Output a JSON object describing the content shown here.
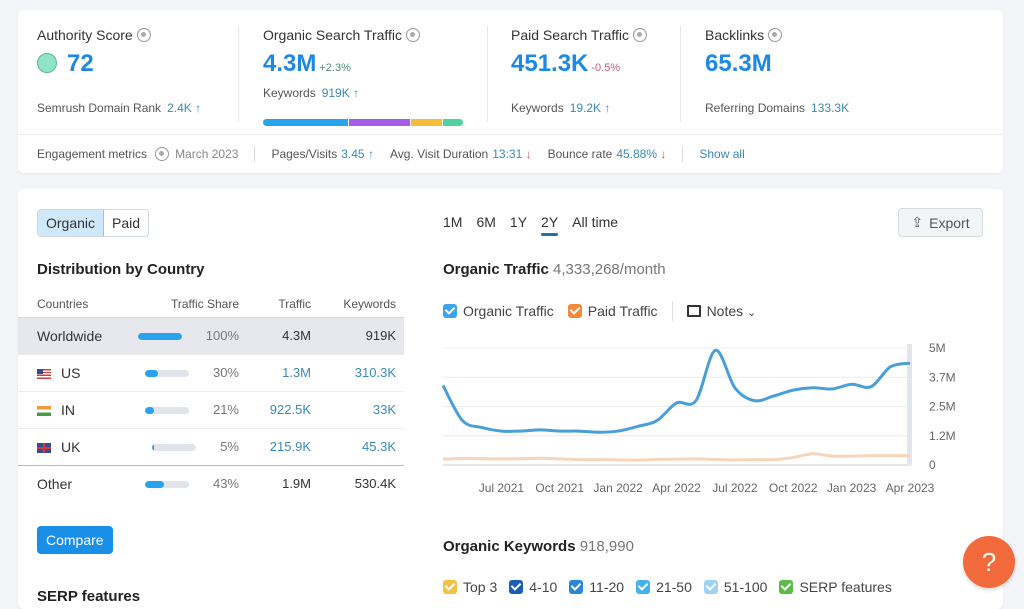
{
  "summary": {
    "authority_score": {
      "title": "Authority Score",
      "value": "72",
      "sub_label": "Semrush Domain Rank",
      "sub_value": "2.4K",
      "sub_trend": "up"
    },
    "organic_search": {
      "title": "Organic Search Traffic",
      "value": "4.3M",
      "delta": "+2.3%",
      "sub_label": "Keywords",
      "sub_value": "919K",
      "sub_trend": "up",
      "keyword_distribution": [
        {
          "color": "#2aa3ef",
          "share": 0.43
        },
        {
          "color": "#a35de8",
          "share": 0.31
        },
        {
          "color": "#f5bd3a",
          "share": 0.16
        },
        {
          "color": "#4fd2a0",
          "share": 0.1
        }
      ]
    },
    "paid_search": {
      "title": "Paid Search Traffic",
      "value": "451.3K",
      "delta": "-0.5%",
      "sub_label": "Keywords",
      "sub_value": "19.2K",
      "sub_trend": "up"
    },
    "backlinks": {
      "title": "Backlinks",
      "value": "65.3M",
      "sub_label": "Referring Domains",
      "sub_value": "133.3K"
    }
  },
  "engagement": {
    "label": "Engagement metrics",
    "date": "March 2023",
    "pages_visits_label": "Pages/Visits",
    "pages_visits": "3.45",
    "pages_visits_trend": "up",
    "avg_duration_label": "Avg. Visit Duration",
    "avg_duration": "13:31",
    "avg_duration_trend": "down",
    "bounce_label": "Bounce rate",
    "bounce": "45.88%",
    "bounce_trend": "down",
    "show_all": "Show all"
  },
  "toggle": {
    "organic": "Organic",
    "paid": "Paid",
    "selected": "Organic"
  },
  "distribution": {
    "title": "Distribution by Country",
    "columns": [
      "Countries",
      "Traffic Share",
      "Traffic",
      "Keywords"
    ],
    "rows": [
      {
        "country": "Worldwide",
        "flag": "",
        "share": 100,
        "share_label": "100%",
        "traffic": "4.3M",
        "keywords": "919K"
      },
      {
        "country": "US",
        "flag": "us",
        "share": 30,
        "share_label": "30%",
        "traffic": "1.3M",
        "keywords": "310.3K"
      },
      {
        "country": "IN",
        "flag": "in",
        "share": 21,
        "share_label": "21%",
        "traffic": "922.5K",
        "keywords": "33K"
      },
      {
        "country": "UK",
        "flag": "uk",
        "share": 5,
        "share_label": "5%",
        "traffic": "215.9K",
        "keywords": "45.3K"
      },
      {
        "country": "Other",
        "flag": "",
        "share": 43,
        "share_label": "43%",
        "traffic": "1.9M",
        "keywords": "530.4K"
      }
    ],
    "compare_label": "Compare",
    "serp_label": "SERP features"
  },
  "range_tabs": [
    "1M",
    "6M",
    "1Y",
    "2Y",
    "All time"
  ],
  "range_selected": "2Y",
  "export_label": "Export",
  "organic_traffic": {
    "title": "Organic Traffic",
    "value": "4,333,268/month"
  },
  "legend": {
    "organic": "Organic Traffic",
    "paid": "Paid Traffic",
    "notes": "Notes"
  },
  "colors": {
    "organic": "#4a9fd8",
    "paid": "#f7d5bb",
    "organic_check": "#3da4ec",
    "paid_check": "#f28a3b"
  },
  "chart_data": {
    "type": "line",
    "title": "Organic Traffic",
    "x": [
      "Apr 2021",
      "May 2021",
      "Jun 2021",
      "Jul 2021",
      "Aug 2021",
      "Sep 2021",
      "Oct 2021",
      "Nov 2021",
      "Dec 2021",
      "Jan 2022",
      "Feb 2022",
      "Mar 2022",
      "Apr 2022",
      "May 2022",
      "Jun 2022",
      "Jul 2022",
      "Aug 2022",
      "Sep 2022",
      "Oct 2022",
      "Nov 2022",
      "Dec 2022",
      "Jan 2023",
      "Feb 2023",
      "Mar 2023",
      "Apr 2023"
    ],
    "x_tick_labels": [
      "Jul 2021",
      "Oct 2021",
      "Jan 2022",
      "Apr 2022",
      "Jul 2022",
      "Oct 2022",
      "Jan 2023",
      "Apr 2023"
    ],
    "y_tick_labels": [
      "5M",
      "3.7M",
      "2.5M",
      "1.2M",
      "0"
    ],
    "ylim": [
      0,
      5000000
    ],
    "grid": true,
    "series": [
      {
        "name": "Organic Traffic",
        "values": [
          3400000,
          1900000,
          1600000,
          1450000,
          1450000,
          1500000,
          1450000,
          1450000,
          1400000,
          1450000,
          1650000,
          1900000,
          2650000,
          2750000,
          4900000,
          3300000,
          2750000,
          2950000,
          3200000,
          3300000,
          3250000,
          3450000,
          3350000,
          4200000,
          4350000
        ]
      },
      {
        "name": "Paid Traffic",
        "values": [
          250000,
          280000,
          270000,
          260000,
          270000,
          290000,
          260000,
          230000,
          230000,
          220000,
          210000,
          240000,
          250000,
          260000,
          240000,
          220000,
          230000,
          230000,
          320000,
          480000,
          380000,
          380000,
          400000,
          400000,
          400000
        ]
      }
    ]
  },
  "organic_keywords": {
    "title": "Organic Keywords",
    "value": "918,990",
    "legend": [
      {
        "label": "Top 3",
        "color": "#f5c046"
      },
      {
        "label": "4-10",
        "color": "#1a5fb4"
      },
      {
        "label": "11-20",
        "color": "#2a86d8"
      },
      {
        "label": "21-50",
        "color": "#45b0ef"
      },
      {
        "label": "51-100",
        "color": "#9fd3f5"
      },
      {
        "label": "SERP features",
        "color": "#5cba47"
      }
    ]
  },
  "help_label": "?"
}
